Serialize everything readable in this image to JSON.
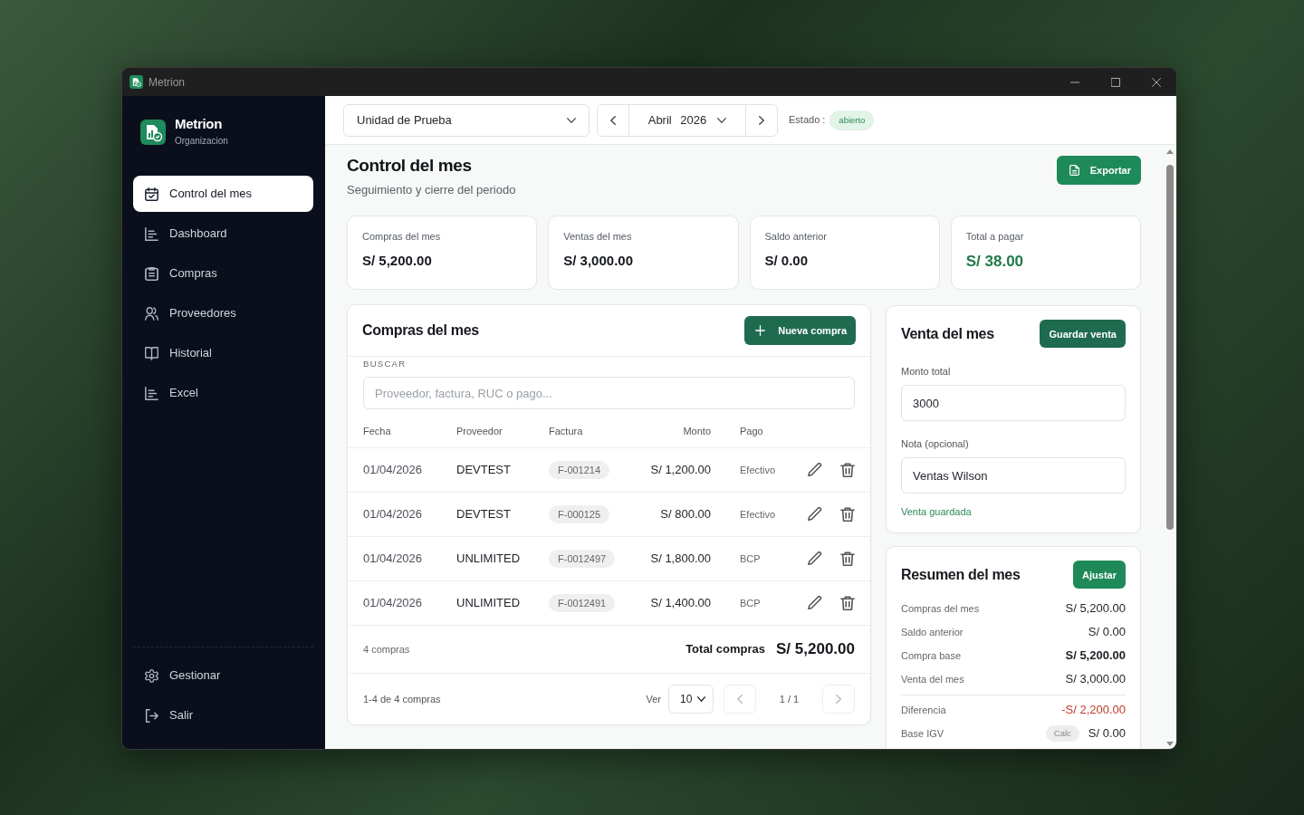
{
  "window": {
    "title": "Metrion"
  },
  "sidebar": {
    "brand": {
      "name": "Metrion",
      "subtitle": "Organizacion"
    },
    "items": [
      {
        "label": "Control del mes",
        "selected": true
      },
      {
        "label": "Dashboard",
        "selected": false
      },
      {
        "label": "Compras",
        "selected": false
      },
      {
        "label": "Proveedores",
        "selected": false
      },
      {
        "label": "Historial",
        "selected": false
      },
      {
        "label": "Excel",
        "selected": false
      }
    ],
    "footer_items": [
      {
        "label": "Gestionar",
        "selected": false
      },
      {
        "label": "Salir",
        "selected": false
      }
    ]
  },
  "topbar": {
    "unit": "Unidad de Prueba",
    "period": "Abril 2026",
    "status_label": "Estado :",
    "status": "abierto"
  },
  "header": {
    "title": "Control del mes",
    "subtitle": "Seguimiento y cierre del periodo",
    "export_button": "Exportar"
  },
  "stats": [
    {
      "label": "Compras del mes",
      "value": "S/ 5,200.00",
      "highlight": false
    },
    {
      "label": "Ventas del mes",
      "value": "S/ 3,000.00",
      "highlight": false
    },
    {
      "label": "Saldo anterior",
      "value": "S/ 0.00",
      "highlight": false
    },
    {
      "label": "Total a pagar",
      "value": "S/ 38.00",
      "highlight": true
    }
  ],
  "purchases": {
    "title": "Compras del mes",
    "new_button": "Nueva compra",
    "search": {
      "label": "BUSCAR",
      "placeholder": "Proveedor, factura, RUC o pago..."
    },
    "columns": [
      "Fecha",
      "Proveedor",
      "Factura",
      "Monto",
      "Pago"
    ],
    "rows": [
      {
        "date": "01/04/2026",
        "supplier": "DEVTEST",
        "invoice": "F-001214",
        "amount": "S/ 1,200.00",
        "payment": "Efectivo"
      },
      {
        "date": "01/04/2026",
        "supplier": "DEVTEST",
        "invoice": "F-000125",
        "amount": "S/ 800.00",
        "payment": "Efectivo"
      },
      {
        "date": "01/04/2026",
        "supplier": "UNLIMITED",
        "invoice": "F-0012497",
        "amount": "S/ 1,800.00",
        "payment": "BCP"
      },
      {
        "date": "01/04/2026",
        "supplier": "UNLIMITED",
        "invoice": "F-0012491",
        "amount": "S/ 1,400.00",
        "payment": "BCP"
      }
    ],
    "footer": {
      "count": "4 compras",
      "total_label": "Total compras",
      "total": "S/ 5,200.00"
    },
    "pagination": {
      "range": "1-4 de 4 compras",
      "per_page_label": "Ver",
      "per_page": "10",
      "page": "1 / 1",
      "prev_disabled": true,
      "next_disabled": true
    }
  },
  "sale": {
    "title": "Venta del mes",
    "save_button": "Guardar venta",
    "fields": [
      {
        "label": "Monto total",
        "value": "3000"
      },
      {
        "label": "Nota (opcional)",
        "value": "Ventas Wilson"
      }
    ],
    "message": "Venta guardada"
  },
  "summary": {
    "title": "Resumen del mes",
    "adjust_button": "Ajustar",
    "sections": [
      {
        "rows": [
          {
            "label": "Compras del mes",
            "value": "S/ 5,200.00",
            "kind": "plain"
          },
          {
            "label": "Saldo anterior",
            "value": "S/ 0.00",
            "kind": "plain"
          },
          {
            "label": "Compra base",
            "value": "S/ 5,200.00",
            "kind": "strong"
          },
          {
            "label": "Venta del mes",
            "value": "S/ 3,000.00",
            "kind": "plain"
          }
        ]
      },
      {
        "rows": [
          {
            "label": "Diferencia",
            "value": "-S/ 2,200.00",
            "kind": "negative"
          },
          {
            "label": "Base IGV",
            "tag": "Calc",
            "value": "S/ 0.00",
            "kind": "plain"
          }
        ]
      }
    ]
  }
}
